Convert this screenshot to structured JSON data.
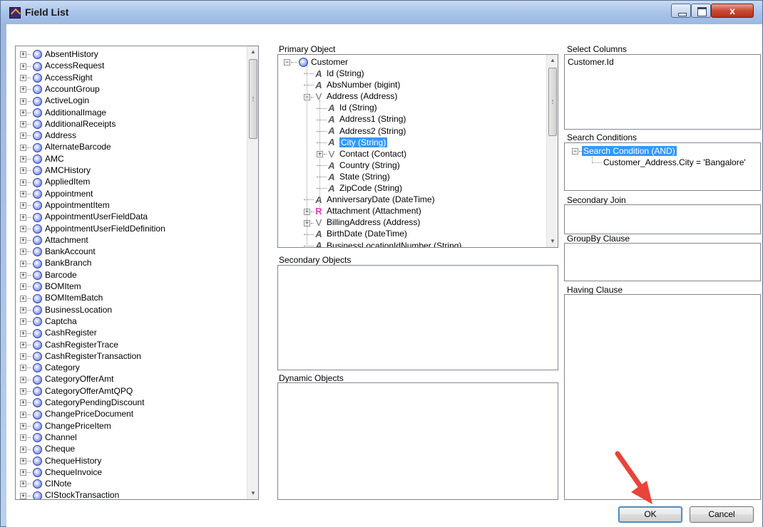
{
  "window": {
    "title": "Field List",
    "close_glyph": "x"
  },
  "colors": {
    "selection": "#3399ff",
    "accent_arrow": "#e8443a"
  },
  "icons": {
    "expand": "+",
    "collapse": "−",
    "scroll_up": "▲",
    "scroll_down": "▼",
    "string": "A",
    "object": "V",
    "attachment": "R"
  },
  "left_tree": {
    "items": [
      "AbsentHistory",
      "AccessRequest",
      "AccessRight",
      "AccountGroup",
      "ActiveLogin",
      "AdditionalImage",
      "AdditionalReceipts",
      "Address",
      "AlternateBarcode",
      "AMC",
      "AMCHistory",
      "AppliedItem",
      "Appointment",
      "AppointmentItem",
      "AppointmentUserFieldData",
      "AppointmentUserFieldDefinition",
      "Attachment",
      "BankAccount",
      "BankBranch",
      "Barcode",
      "BOMItem",
      "BOMItemBatch",
      "BusinessLocation",
      "Captcha",
      "CashRegister",
      "CashRegisterTrace",
      "CashRegisterTransaction",
      "Category",
      "CategoryOfferAmt",
      "CategoryOfferAmtQPQ",
      "CategoryPendingDiscount",
      "ChangePriceDocument",
      "ChangePriceItem",
      "Channel",
      "Cheque",
      "ChequeHistory",
      "ChequeInvoice",
      "CINote",
      "CIStockTransaction"
    ]
  },
  "primary": {
    "label": "Primary Object",
    "root": "Customer",
    "rows": [
      {
        "text": "Id (String)",
        "icon": "string"
      },
      {
        "text": "AbsNumber (bigint)",
        "icon": "string"
      },
      {
        "text": "Address (Address)",
        "icon": "object"
      },
      {
        "text": "Id (String)",
        "icon": "string"
      },
      {
        "text": "Address1 (String)",
        "icon": "string"
      },
      {
        "text": "Address2 (String)",
        "icon": "string"
      },
      {
        "text": "City (String)",
        "icon": "string"
      },
      {
        "text": "Contact (Contact)",
        "icon": "object"
      },
      {
        "text": "Country (String)",
        "icon": "string"
      },
      {
        "text": "State (String)",
        "icon": "string"
      },
      {
        "text": "ZipCode (String)",
        "icon": "string"
      },
      {
        "text": "AnniversaryDate (DateTime)",
        "icon": "string"
      },
      {
        "text": "Attachment (Attachment)",
        "icon": "attachment"
      },
      {
        "text": "BillingAddress (Address)",
        "icon": "object"
      },
      {
        "text": "BirthDate (DateTime)",
        "icon": "string"
      },
      {
        "text": "BusinessLocationIdNumber (String)",
        "icon": "string"
      }
    ]
  },
  "secondary_objects": {
    "label": "Secondary Objects"
  },
  "dynamic_objects": {
    "label": "Dynamic Objects"
  },
  "select_columns": {
    "label": "Select Columns",
    "value": "Customer.Id"
  },
  "search_conditions": {
    "label": "Search Conditions",
    "root": "Search Condition (AND)",
    "child": "Customer_Address.City = 'Bangalore'"
  },
  "secondary_join": {
    "label": "Secondary Join"
  },
  "group_by": {
    "label": "GroupBy Clause"
  },
  "having": {
    "label": "Having Clause"
  },
  "buttons": {
    "ok": "OK",
    "cancel": "Cancel"
  }
}
